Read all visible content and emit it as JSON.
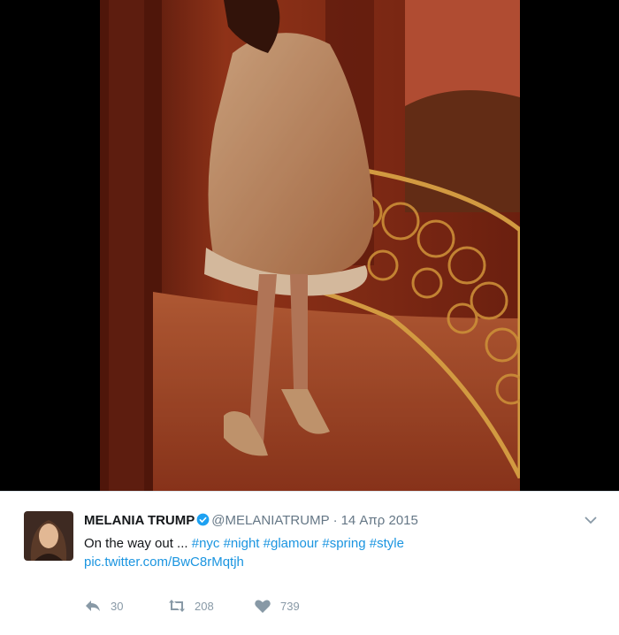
{
  "tweet": {
    "display_name": "MELANIA TRUMP",
    "handle": "@MELANIATRUMP",
    "separator": "·",
    "timestamp": "14 Απρ 2015",
    "text_prefix": "On the way out ...",
    "hashtags": [
      "#nyc",
      "#night",
      "#glamour",
      "#spring",
      "#style"
    ],
    "media_link": "pic.twitter.com/BwC8rMqtjh",
    "reply_count": "30",
    "retweet_count": "208",
    "like_count": "739"
  },
  "icons": {
    "verified": "verified-badge-icon",
    "menu": "chevron-down-icon",
    "reply": "reply-icon",
    "retweet": "retweet-icon",
    "like": "heart-icon"
  },
  "colors": {
    "link": "#1b95e0",
    "verified": "#1da1f2",
    "muted": "#8899a6"
  }
}
